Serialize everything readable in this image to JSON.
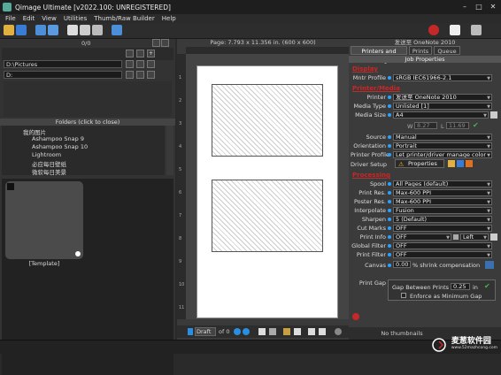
{
  "window": {
    "title": "Qimage Ultimate [v2022.100: UNREGISTERED]"
  },
  "menu": [
    "File",
    "Edit",
    "View",
    "Utilities",
    "Thumb/Raw Builder",
    "Help"
  ],
  "left_panel": {
    "counter": "0/0",
    "path": "D:\\Pictures",
    "drive": "D:",
    "folders_header": "Folders (click to close)",
    "folders": [
      "我的图片",
      "Ashampoo Snap 9",
      "Ashampoo Snap 10",
      "Lightroom",
      "必应每日壁纸",
      "微软每日美景"
    ],
    "thumbnail_label": "[Template]"
  },
  "center": {
    "page_info": "Page: 7.793 x 11.356 in. (600 x 600)",
    "ruler_left": [
      "1",
      "2",
      "3",
      "4",
      "5",
      "6",
      "7",
      "8",
      "9",
      "10",
      "11"
    ],
    "draft_label": "Draft",
    "page_of": "of 0"
  },
  "right_panel": {
    "printer_header": "发送至 OneNote 2010",
    "tabs": [
      "Printers and Settings",
      "Prints",
      "Queue"
    ],
    "subheader": "Job Properties",
    "display": {
      "title": "Display",
      "monitor_profile_label": "Mntr Profile",
      "monitor_profile": "sRGB IEC61966-2.1"
    },
    "printer_media": {
      "title": "Printer/Media",
      "printer_label": "Printer",
      "printer": "发送至 OneNote 2010",
      "media_type_label": "Media Type",
      "media_type": "Unlisted [1]",
      "media_size_label": "Media Size",
      "media_size": "A4",
      "w_label": "W",
      "w_value": "8.27",
      "l_label": "L",
      "l_value": "11.69",
      "source_label": "Source",
      "source": "Manual",
      "orientation_label": "Orientation",
      "orientation": "Portrait",
      "printer_profile_label": "Printer Profile",
      "printer_profile": "Let printer/driver manage color",
      "driver_setup_label": "Driver Setup",
      "properties_label": "Properties"
    },
    "processing": {
      "title": "Processing",
      "rows": [
        {
          "label": "Spool",
          "value": "All Pages (default)"
        },
        {
          "label": "Print Res.",
          "value": "Max-600 PPI"
        },
        {
          "label": "Poster Res.",
          "value": "Max-600 PPI"
        },
        {
          "label": "Interpolate",
          "value": "Fusion"
        },
        {
          "label": "Sharpen",
          "value": "5 (Default)"
        },
        {
          "label": "Cut Marks",
          "value": "OFF"
        },
        {
          "label": "Print Info",
          "value": "OFF",
          "position": "Left"
        },
        {
          "label": "Global Filter",
          "value": "OFF"
        },
        {
          "label": "Print Filter",
          "value": "OFF"
        }
      ],
      "canvas_label": "Canvas",
      "canvas_value": "0.00",
      "shrink_label": "% shrink compensation",
      "print_gap_label": "Print Gap",
      "gap_between_label": "Gap Between Prints",
      "gap_value": "0.25",
      "gap_unit": "in",
      "enforce_label": "Enforce as Minimum Gap"
    },
    "bottom_label": "No thumbnails"
  },
  "watermark": {
    "text": "麦葱软件园",
    "url": "www.52mazhcong.com"
  },
  "colors": {
    "accent_red": "#c62828",
    "accent_blue": "#2aa3ff",
    "bg": "#2a2a2a"
  }
}
